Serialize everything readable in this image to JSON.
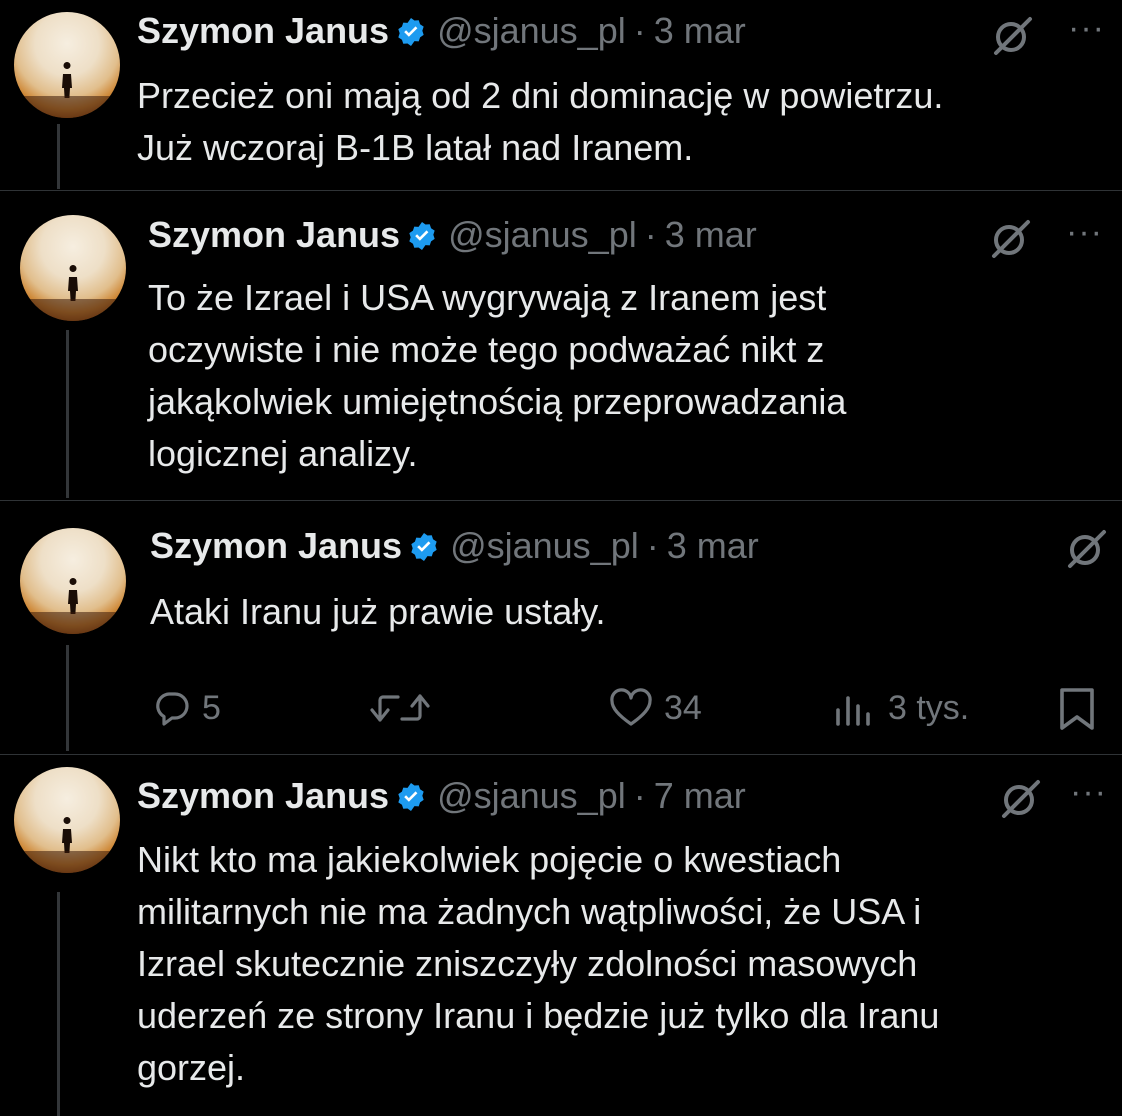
{
  "tweets": [
    {
      "author": {
        "name": "Szymon Janus",
        "handle": "@sjanus_pl"
      },
      "separator": "·",
      "date": "3 mar",
      "text": "Przecież oni mają od 2 dni dominację w powietrzu.\nJuż wczoraj B-1B latał nad Iranem."
    },
    {
      "author": {
        "name": "Szymon Janus",
        "handle": "@sjanus_pl"
      },
      "separator": "·",
      "date": "3 mar",
      "text": "To że Izrael i USA wygrywają z Iranem jest\noczywiste i nie może tego podważać nikt z\njakąkolwiek umiejętnością przeprowadzania\nlogicznej analizy."
    },
    {
      "author": {
        "name": "Szymon Janus",
        "handle": "@sjanus_pl"
      },
      "separator": "·",
      "date": "3 mar",
      "text": "Ataki Iranu już prawie ustały.",
      "actions": {
        "replies": "5",
        "retweets": "",
        "likes": "34",
        "views": "3 tys."
      }
    },
    {
      "author": {
        "name": "Szymon Janus",
        "handle": "@sjanus_pl"
      },
      "separator": "·",
      "date": "7 mar",
      "text": "Nikt kto ma jakiekolwiek pojęcie o kwestiach\nmilitarnych nie ma żadnych wątpliwości, że USA i\nIzrael skutecznie zniszczyły zdolności masowych\nuderzeń ze strony Iranu i będzie już tylko dla Iranu\ngorzej."
    }
  ],
  "icons": {
    "verified_badge": "verified-badge-icon",
    "grok": "grok-icon",
    "more": "more-icon",
    "reply": "reply-icon",
    "retweet": "retweet-icon",
    "like": "like-icon",
    "views": "views-icon",
    "bookmark": "bookmark-icon"
  },
  "colors": {
    "background": "#000000",
    "text_primary": "#e7e9ea",
    "text_secondary": "#71767b",
    "verified_blue": "#1d9bf0",
    "divider": "#2f3336"
  },
  "more_label": "···"
}
